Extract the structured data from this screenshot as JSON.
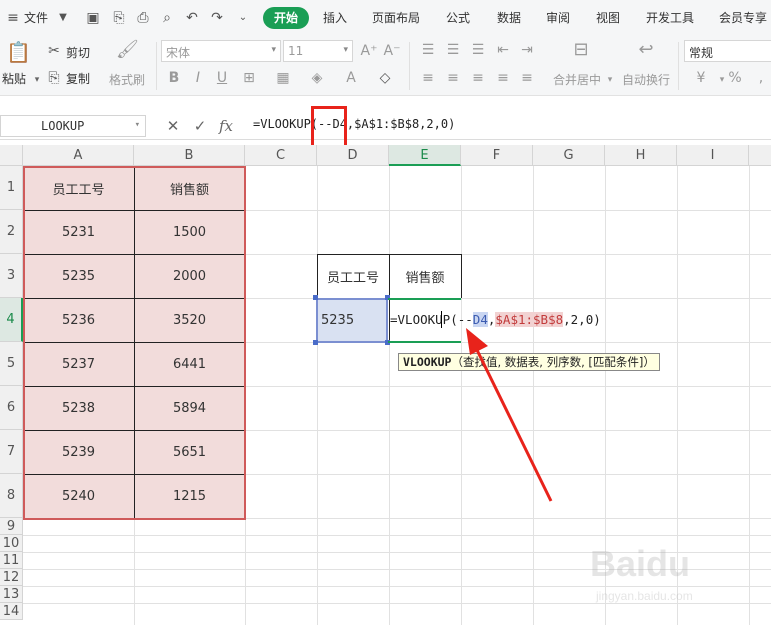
{
  "menubar": {
    "file_label": "文件",
    "tabs": [
      "开始",
      "插入",
      "页面布局",
      "公式",
      "数据",
      "审阅",
      "视图",
      "开发工具",
      "会员专享"
    ]
  },
  "ribbon": {
    "paste": "粘贴",
    "cut": "剪切",
    "copy": "复制",
    "format_painter": "格式刷",
    "font_name": "宋体",
    "font_size": "11",
    "merge_center": "合并居中",
    "wrap_text": "自动换行",
    "number_format": "常规"
  },
  "formula_bar": {
    "name_box": "LOOKUP",
    "fx": "fx",
    "formula": "=VLOOKUP(--D4,$A$1:$B$8,2,0)"
  },
  "sheet": {
    "columns": [
      "A",
      "B",
      "C",
      "D",
      "E",
      "F",
      "G",
      "H",
      "I"
    ],
    "rows": [
      "1",
      "2",
      "3",
      "4",
      "5",
      "6",
      "7",
      "8",
      "9",
      "10",
      "11",
      "12",
      "13",
      "14"
    ],
    "table_headers": [
      "员工工号",
      "销售额"
    ],
    "table_rows": [
      [
        "5231",
        "1500"
      ],
      [
        "5235",
        "2000"
      ],
      [
        "5236",
        "3520"
      ],
      [
        "5237",
        "6441"
      ],
      [
        "5238",
        "5894"
      ],
      [
        "5239",
        "5651"
      ],
      [
        "5240",
        "1215"
      ]
    ],
    "lookup_headers": [
      "员工工号",
      "销售额"
    ],
    "lookup_id": "5235",
    "edit_parts": {
      "prefix": "=VLOOKUP(--",
      "ref1": "D4",
      "sep1": ",",
      "ref2": "$A$1:$B$8",
      "suffix": ",2,0)"
    }
  },
  "tooltip": {
    "func": "VLOOKUP",
    "args": "（查找值, 数据表, 列序数, [匹配条件]）"
  },
  "watermark": {
    "logo": "Baidu",
    "sub": "jingyan.baidu.com"
  },
  "colors": {
    "accent": "#1a9e55",
    "table_fill": "#f2dcdb",
    "highlight_red": "#e8231b"
  }
}
